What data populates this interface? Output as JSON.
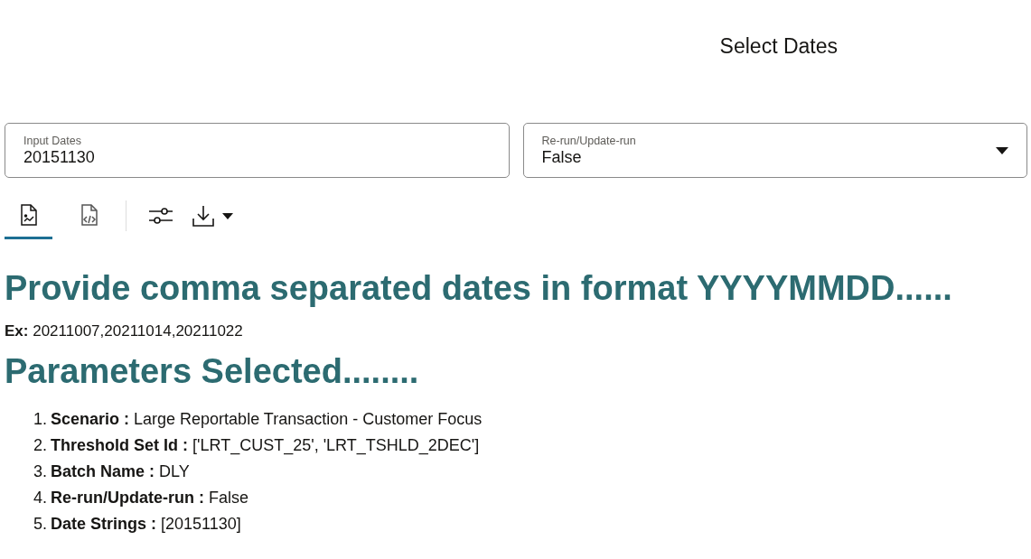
{
  "title": "Select Dates",
  "fields": [
    {
      "kind": "text",
      "label": "Input Dates",
      "value": "20151130"
    },
    {
      "kind": "select",
      "label": "Re-run/Update-run",
      "value": "False"
    }
  ],
  "tabs": [
    {
      "kind": "chart",
      "selected": true
    },
    {
      "kind": "code",
      "selected": false
    }
  ],
  "heading": "Provide comma separated dates in format YYYYMMDD......",
  "example": "**Ex:** 20211007,20211014,20211022",
  "params_heading": "Parameters Selected........",
  "params": [
    {
      "number": "1.",
      "text": "**Scenario :** Large Reportable Transaction - Customer Focus"
    },
    {
      "number": "2.",
      "text": "**Threshold Set Id :** ['LRT_CUST_25', 'LRT_TSHLD_2DEC']"
    },
    {
      "number": "3.",
      "text": "**Batch Name :** DLY"
    },
    {
      "number": "4.",
      "text": "**Re-run/Update-run :** False"
    },
    {
      "number": "5.",
      "text": "**Date Strings :** [20151130]"
    }
  ]
}
